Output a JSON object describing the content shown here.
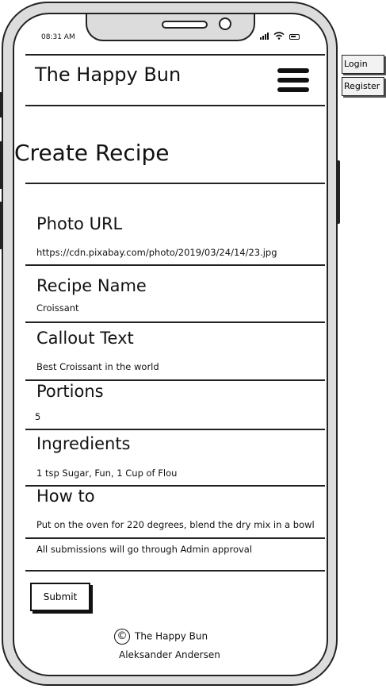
{
  "status": {
    "time": "08:31 AM"
  },
  "header": {
    "app_title": "The Happy Bun"
  },
  "page": {
    "title": "Create Recipe"
  },
  "form": {
    "fields": [
      {
        "label": "Photo URL",
        "value": "https://cdn.pixabay.com/photo/2019/03/24/14/23.jpg"
      },
      {
        "label": "Recipe Name",
        "value": "Croissant"
      },
      {
        "label": "Callout Text",
        "value": "Best Croissant in the world"
      },
      {
        "label": "Portions",
        "value": "5"
      },
      {
        "label": "Ingredients",
        "value": "1 tsp Sugar, Fun, 1 Cup of Flou"
      },
      {
        "label": "How to",
        "value": "Put on the oven for 220 degrees, blend the dry mix in a bowl"
      }
    ],
    "note": "All submissions will go through Admin approval",
    "submit_label": "Submit"
  },
  "footer": {
    "copyright_symbol": "©",
    "line1": "The Happy Bun",
    "line2": "Aleksander Andersen"
  },
  "floating": {
    "login_label": "Login",
    "register_label": "Register"
  }
}
